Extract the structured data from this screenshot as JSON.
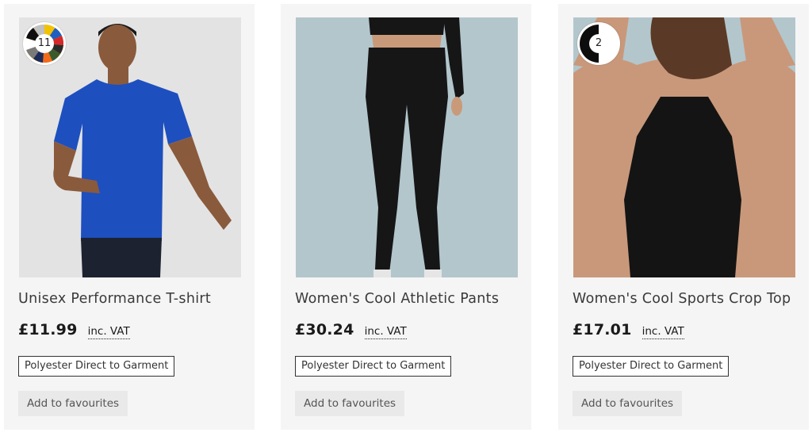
{
  "products": [
    {
      "title": "Unisex Performance T-shirt",
      "price": "£11.99",
      "vat_label": "inc. VAT",
      "badge": "Polyester Direct to Garment",
      "fav_label": "Add to favourites",
      "swatch_count": "11",
      "swatch_colors": [
        "#f2c200",
        "#1f5fbf",
        "#d62828",
        "#2b2b2b",
        "#ffffff",
        "#1c2b5a",
        "#f26a1b",
        "#3a5a2e",
        "#7a7a7a",
        "#0d0d0d",
        "#c0c0c0"
      ],
      "image_bg": "#e3e3e3",
      "garment_color": "#1d4fbf"
    },
    {
      "title": "Women's Cool Athletic Pants",
      "price": "£30.24",
      "vat_label": "inc. VAT",
      "badge": "Polyester Direct to Garment",
      "fav_label": "Add to favourites",
      "image_bg": "#b3c6cc",
      "garment_color": "#161616"
    },
    {
      "title": "Women's Cool Sports Crop Top",
      "price": "£17.01",
      "vat_label": "inc. VAT",
      "badge": "Polyester Direct to Garment",
      "fav_label": "Add to favourites",
      "swatch_count": "2",
      "swatch_colors": [
        "#0d0d0d",
        "#ffffff"
      ],
      "image_bg": "#b3c6cc",
      "garment_color": "#141414"
    }
  ]
}
